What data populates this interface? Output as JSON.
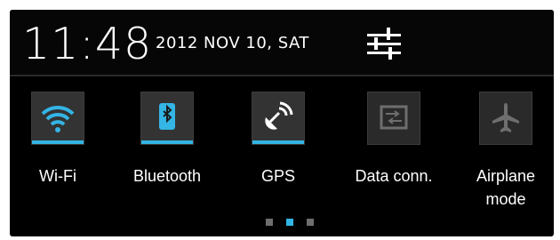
{
  "status": {
    "time": "11:48",
    "date": "2012 NOV 10, SAT",
    "settings_icon": "settings-sliders-icon"
  },
  "quick_settings": [
    {
      "label": "Wi-Fi",
      "icon": "wifi-icon",
      "enabled": true
    },
    {
      "label": "Bluetooth",
      "icon": "bluetooth-icon",
      "enabled": true
    },
    {
      "label": "GPS",
      "icon": "gps-satellite-icon",
      "enabled": true
    },
    {
      "label": "Data conn.",
      "icon": "data-connection-icon",
      "enabled": false
    },
    {
      "label": "Airplane mode",
      "icon": "airplane-icon",
      "enabled": false
    }
  ],
  "pager": {
    "pages": 3,
    "current": 2
  },
  "colors": {
    "accent": "#33b5e5",
    "background": "#000000",
    "tile": "#2a2a2a",
    "inactive_icon": "#6e6e6e"
  }
}
